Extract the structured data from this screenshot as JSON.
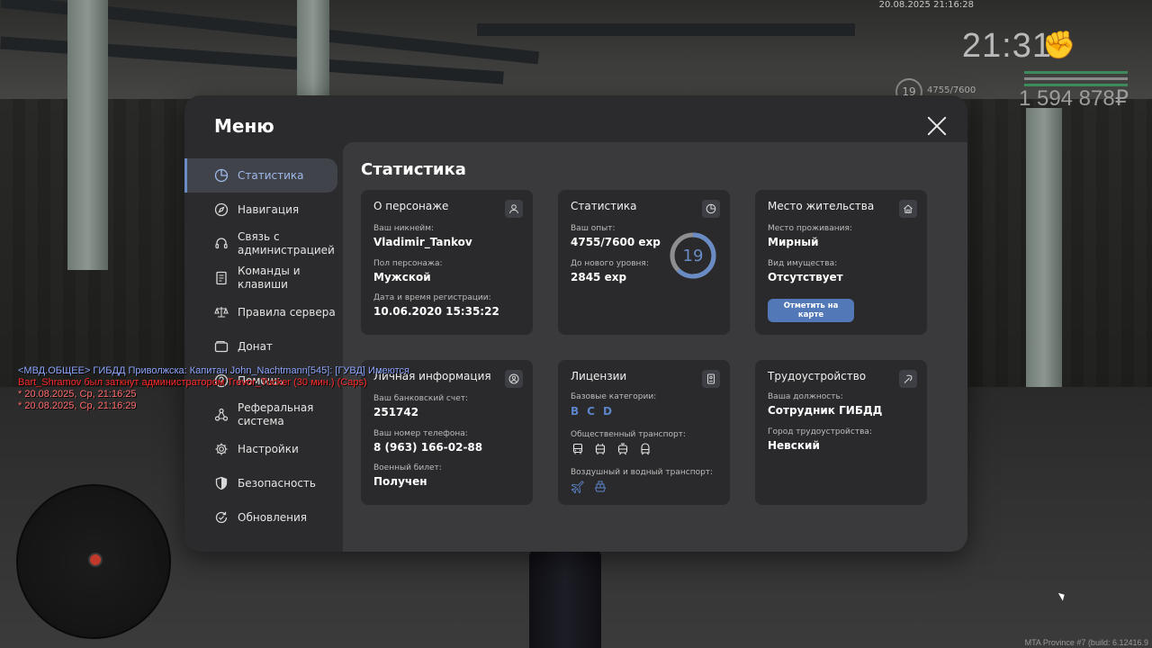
{
  "hud": {
    "datetime": "20.08.2025 21:16:28",
    "clock": "21:31",
    "level": "19",
    "exp": "4755/7600",
    "money": "1 594 878₽",
    "fist_icon": "fist-icon",
    "bar_colors": [
      "#3d8a5c",
      "#8a8a8a",
      "#3d8a5c"
    ]
  },
  "chat": [
    {
      "text": "<МВД.ОБЩЕЕ> ГИБДД Приволжска: Капитан John_Nachtmann[545]: [ГУВД] Имеются",
      "color": "blue"
    },
    {
      "text": "Bart_Shramov был заткнут администратором Trevor_Tucker (30 мин.) (Caps)",
      "color": "red"
    },
    {
      "text": "* 20.08.2025, Ср, 21:16:25",
      "color": "stamp"
    },
    {
      "text": "* 20.08.2025, Ср, 21:16:29",
      "color": "stamp"
    }
  ],
  "build": "MTA Province #7 (build: 6.12416.9",
  "menu": {
    "title": "Меню",
    "sidebar": [
      {
        "label": "Статистика",
        "icon": "pie-chart-icon",
        "active": true
      },
      {
        "label": "Навигация",
        "icon": "compass-icon"
      },
      {
        "label": "Связь с администрацией",
        "icon": "headset-icon"
      },
      {
        "label": "Команды и клавиши",
        "icon": "document-icon"
      },
      {
        "label": "Правила сервера",
        "icon": "scales-icon"
      },
      {
        "label": "Донат",
        "icon": "wallet-icon"
      },
      {
        "label": "Помощь",
        "icon": "help-icon"
      },
      {
        "label": "Реферальная система",
        "icon": "network-icon"
      },
      {
        "label": "Настройки",
        "icon": "gear-icon"
      },
      {
        "label": "Безопасность",
        "icon": "shield-icon"
      },
      {
        "label": "Обновления",
        "icon": "refresh-icon"
      }
    ]
  },
  "stats": {
    "title": "Статистика",
    "character": {
      "title": "О персонаже",
      "nick_label": "Ваш никнейм:",
      "nick": "Vladimir_Tankov",
      "gender_label": "Пол персонажа:",
      "gender": "Мужской",
      "reg_label": "Дата и время регистрации:",
      "reg": "10.06.2020 15:35:22"
    },
    "statistics": {
      "title": "Статистика",
      "exp_label": "Ваш опыт:",
      "exp": "4755/7600 exp",
      "next_label": "До нового уровня:",
      "next": "2845 exp",
      "level": "19",
      "progress": 0.6257,
      "ring_color": "#6a8cc5"
    },
    "residence": {
      "title": "Место жительства",
      "place_label": "Место проживания:",
      "place": "Мирный",
      "property_label": "Вид имущества:",
      "property": "Отсутствует",
      "button": "Отметить на карте"
    },
    "personal": {
      "title": "Личная информация",
      "bank_label": "Ваш банковский счет:",
      "bank": "251742",
      "phone_label": "Ваш номер телефона:",
      "phone": "8 (963) 166-02-88",
      "military_label": "Военный билет:",
      "military": "Получен"
    },
    "licenses": {
      "title": "Лицензии",
      "base_label": "Базовые категории:",
      "categories": [
        "B",
        "C",
        "D"
      ],
      "public_label": "Общественный транспорт:",
      "air_label": "Воздушный и водный транспорт:"
    },
    "employment": {
      "title": "Трудоустройство",
      "position_label": "Ваша должность:",
      "position": "Сотрудник ГИБДД",
      "city_label": "Город трудоустройства:",
      "city": "Невский"
    }
  }
}
